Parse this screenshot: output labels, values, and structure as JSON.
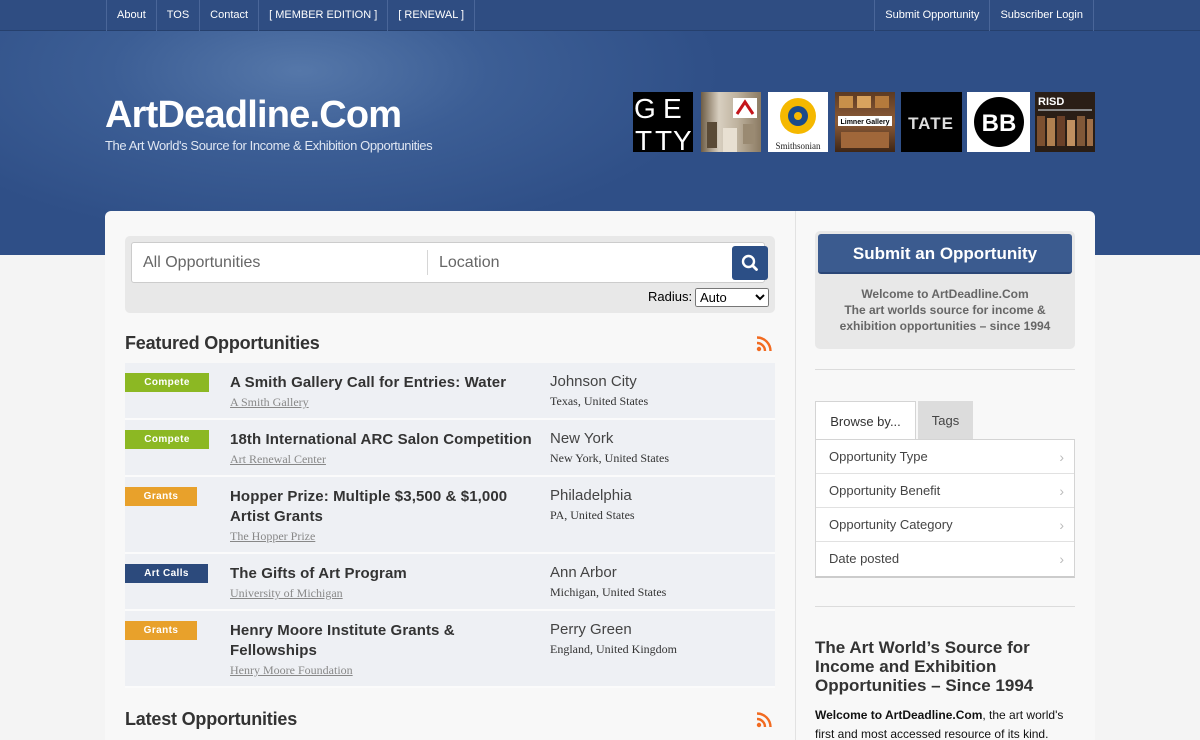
{
  "topnav": {
    "left": [
      "About",
      "TOS",
      "Contact",
      "[ MEMBER EDITION ]",
      "[ RENEWAL ]"
    ],
    "right": [
      "Submit Opportunity",
      "Subscriber Login"
    ]
  },
  "header": {
    "brand": "ArtDeadline.Com",
    "tagline": "The Art World's Source for Income & Exhibition Opportunities",
    "logos": [
      "GETTY",
      "Limner Gallery",
      "Smithsonian",
      "TATE",
      "BB",
      "RISD"
    ]
  },
  "search": {
    "what_placeholder": "All Opportunities",
    "where_placeholder": "Location",
    "radius_label": "Radius:",
    "radius_value": "Auto"
  },
  "featured": {
    "heading": "Featured Opportunities",
    "items": [
      {
        "badge": "Compete",
        "title": "A Smith Gallery Call for Entries: Water",
        "org": "A Smith Gallery",
        "city": "Johnson City",
        "region": "Texas, United States"
      },
      {
        "badge": "Compete",
        "title": "18th International ARC Salon Competition",
        "org": "Art Renewal Center",
        "city": "New York",
        "region": "New York, United States"
      },
      {
        "badge": "Grants",
        "title": "Hopper Prize: Multiple $3,500 & $1,000 Artist Grants",
        "org": "The Hopper Prize",
        "city": "Philadelphia",
        "region": "PA, United States"
      },
      {
        "badge": "Art Calls",
        "title": "The Gifts of Art Program",
        "org": "University of Michigan",
        "city": "Ann Arbor",
        "region": "Michigan, United States"
      },
      {
        "badge": "Grants",
        "title": "Henry Moore Institute Grants & Fellowships",
        "org": "Henry Moore Foundation",
        "city": "Perry Green",
        "region": "England, United Kingdom"
      }
    ]
  },
  "latest": {
    "heading": "Latest Opportunities"
  },
  "sidebar": {
    "submit_label": "Submit an Opportunity",
    "welcome_1": "Welcome to ArtDeadline.Com",
    "welcome_2": "The art worlds source for income &",
    "welcome_3": "exhibition opportunities – since 1994",
    "tab_browse": "Browse by...",
    "tab_tags": "Tags",
    "browse_items": [
      "Opportunity Type",
      "Opportunity Benefit",
      "Opportunity Category",
      "Date posted"
    ],
    "about_title": "The Art World’s Source for Income and Exhibition Opportunities – Since 1994",
    "about_bold": "Welcome to ArtDeadline.Com",
    "about_text": ", the art world's first and most accessed resource of its kind."
  },
  "colors": {
    "nav": "#2f4d82",
    "compete": "#8cb823",
    "grants": "#e8a12b",
    "art_calls": "#2c4a7c",
    "rss": "#f26b21"
  }
}
